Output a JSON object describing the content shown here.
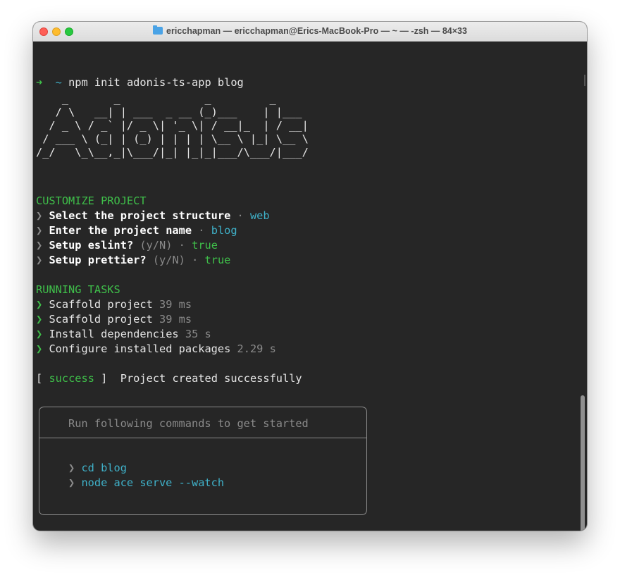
{
  "window": {
    "title": "ericchapman — ericchapman@Erics-MacBook-Pro — ~ — -zsh — 84×33"
  },
  "prompt": {
    "arrow": "➜",
    "dir": "~",
    "command": "npm init adonis-ts-app blog"
  },
  "logo": {
    "art": "    _       _             _         _\n   / \\   __| | ___  _ __ (_)___    | |___\n  / _ \\ / _` |/ _ \\| '_ \\| / __|_  | / __|\n / ___ \\ (_| | (_) | | | | \\__ \\ |_| \\__ \\\n/_/   \\_\\__,_|\\___/|_| |_|_|___/\\___/|___/"
  },
  "customize": {
    "heading": "CUSTOMIZE PROJECT",
    "items": [
      {
        "label": "Select the project structure",
        "hint": "",
        "value": "web"
      },
      {
        "label": "Enter the project name",
        "hint": "",
        "value": "blog"
      },
      {
        "label": "Setup eslint?",
        "hint": "(y/N)",
        "value": "true"
      },
      {
        "label": "Setup prettier?",
        "hint": "(y/N)",
        "value": "true"
      }
    ]
  },
  "tasks": {
    "heading": "RUNNING TASKS",
    "items": [
      {
        "label": "Scaffold project",
        "time": "39 ms"
      },
      {
        "label": "Scaffold project",
        "time": "39 ms"
      },
      {
        "label": "Install dependencies",
        "time": "35 s"
      },
      {
        "label": "Configure installed packages",
        "time": "2.29 s"
      }
    ]
  },
  "result": {
    "open": "[",
    "status": "success",
    "close": "]",
    "message": "Project created successfully"
  },
  "box": {
    "heading": "Run following commands to get started",
    "commands": [
      "cd blog",
      "node ace serve --watch"
    ]
  },
  "final_prompt": {
    "arrow": "➜",
    "dir": "~"
  },
  "chevron": "❯",
  "dot": "·",
  "colors": {
    "background": "#262626",
    "green": "#3fbf4a",
    "cyan": "#3fb1c9",
    "dim": "#8a8a8a"
  }
}
